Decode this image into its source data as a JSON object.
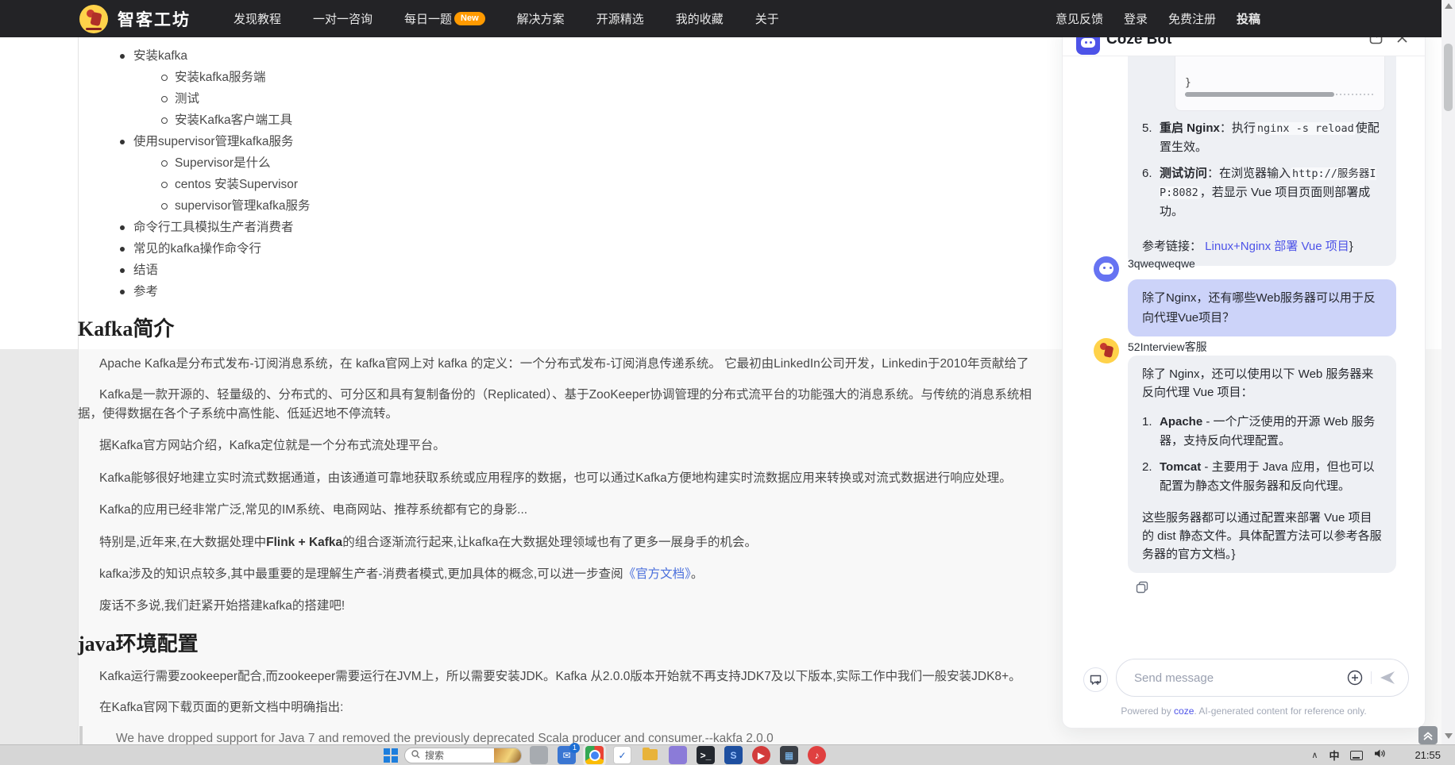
{
  "nav": {
    "brand": "智客工坊",
    "items": [
      {
        "label": "发现教程",
        "badge": ""
      },
      {
        "label": "一对一咨询",
        "badge": ""
      },
      {
        "label": "每日一题",
        "badge": "New"
      },
      {
        "label": "解决方案",
        "badge": ""
      },
      {
        "label": "开源精选",
        "badge": ""
      },
      {
        "label": "我的收藏",
        "badge": ""
      },
      {
        "label": "关于",
        "badge": ""
      }
    ],
    "right_items": {
      "feedback": "意见反馈",
      "login": "登录",
      "register": "免费注册",
      "submit": "投稿"
    }
  },
  "article": {
    "toc": [
      {
        "label": "安装kafka"
      },
      {
        "label": "安装kafka服务端"
      },
      {
        "label": "测试"
      },
      {
        "label": "安装Kafka客户端工具"
      },
      {
        "label": "使用supervisor管理kafka服务"
      },
      {
        "label": "Supervisor是什么"
      },
      {
        "label": "centos 安装Supervisor"
      },
      {
        "label": "supervisor管理kafka服务"
      },
      {
        "label": "命令行工具模拟生产者消费者"
      },
      {
        "label": "常见的kafka操作命令行"
      },
      {
        "label": "结语"
      },
      {
        "label": "参考"
      }
    ],
    "h1": "Kafka简介",
    "p1": "Apache Kafka是分布式发布-订阅消息系统，在 kafka官网上对 kafka 的定义：一个分布式发布-订阅消息传递系统。 它最初由LinkedIn公司开发，Linkedin于2010年贡献给了",
    "p2a": "Kafka是一款开源的、轻量级的、分布式的、可分区和具有复制备份的（Replicated）、基于ZooKeeper协调管理的分布式流平台的功能强大的消息系统。与传统的消息系统相",
    "p2b": "据，使得数据在各个子系统中高性能、低延迟地不停流转。",
    "p3": "据Kafka官方网站介绍，Kafka定位就是一个分布式流处理平台。",
    "p4": "Kafka能够很好地建立实时流式数据通道，由该通道可靠地获取系统或应用程序的数据，也可以通过Kafka方便地构建实时流数据应用来转换或对流式数据进行响应处理。",
    "p5": "Kafka的应用已经非常广泛,常见的IM系统、电商网站、推荐系统都有它的身影...",
    "p6_pre": "特别是,近年来,在大数据处理中",
    "p6_bold": "Flink + Kafka",
    "p6_post": "的组合逐渐流行起来,让kafka在大数据处理领域也有了更多一展身手的机会。",
    "p7_pre": "kafka涉及的知识点较多,其中最重要的是理解生产者-消费者模式,更加具体的概念,可以进一步查阅",
    "p7_link": "《官方文档》",
    "p7_post": "。",
    "p8": "废话不多说,我们赶紧开始搭建kafka的搭建吧!",
    "h2": "java环境配置",
    "p9": "Kafka运行需要zookeeper配合,而zookeeper需要运行在JVM上，所以需要安装JDK。Kafka 从2.0.0版本开始就不再支持JDK7及以下版本,实际工作中我们一般安装JDK8+。",
    "p10": "在Kafka官网下载页面的更新文档中明确指出:",
    "quote": "We have dropped support for Java 7 and removed the previously deprecated Scala producer and consumer.--kakfa 2.0.0"
  },
  "chat": {
    "title": "Coze Bot",
    "code_tail": "}",
    "item5_num": "5.",
    "item5_bold": "重启 Nginx",
    "item5_mid": "：执行",
    "item5_code": "nginx -s reload",
    "item5_post": "使配置生效。",
    "item6_num": "6.",
    "item6_bold": "测试访问",
    "item6_mid": "：在浏览器输入",
    "item6_code": "http://服务器IP:8082",
    "item6_post": "，若显示 Vue 项目页面则部署成功。",
    "ref_pre": "参考链接： ",
    "ref_link": "Linux+Nginx 部署 Vue 项目",
    "ref_post": "}",
    "user_name": "3qweqweqwe",
    "user_text": "除了Nginx，还有哪些Web服务器可以用于反向代理Vue项目？",
    "bot_name": "52Interview客服",
    "bot_p1": "除了 Nginx，还可以使用以下 Web 服务器来反向代理 Vue 项目：",
    "bot_li1_num": "1.",
    "bot_li1_bold": "Apache",
    "bot_li1_rest": " - 一个广泛使用的开源 Web 服务器，支持反向代理配置。",
    "bot_li2_num": "2.",
    "bot_li2_bold": "Tomcat",
    "bot_li2_rest": " - 主要用于 Java 应用，但也可以配置为静态文件服务器和反向代理。",
    "bot_p2": "这些服务器都可以通过配置来部署 Vue 项目的 dist 静态文件。具体配置方法可以参考各服务器的官方文档。}",
    "input_placeholder": "Send message",
    "powered_pre": "Powered by ",
    "powered_link": "coze",
    "powered_post": ". AI-generated content for reference only."
  },
  "taskbar": {
    "search_placeholder": "搜索",
    "tray_ime": "中",
    "time": "21:55",
    "apps": [
      {
        "name": "app-gray",
        "bg": "#a7abb0",
        "glyph": "",
        "glyphColor": "#fff"
      },
      {
        "name": "mail-app",
        "bg": "#3a76d2",
        "glyph": "✉",
        "glyphColor": "#fff",
        "badge": "1"
      },
      {
        "name": "chrome",
        "bg": "",
        "glyph": "",
        "glyphColor": "",
        "active": true
      },
      {
        "name": "check-app",
        "bg": "#ffffff",
        "glyph": "✓",
        "glyphColor": "#2563c9"
      },
      {
        "name": "folder",
        "bg": "",
        "glyph": "",
        "glyphColor": ""
      },
      {
        "name": "purple-app",
        "bg": "#8b7bd8",
        "glyph": "",
        "glyphColor": "#fff"
      },
      {
        "name": "terminal",
        "bg": "#23272e",
        "glyph": ">_",
        "glyphColor": "#fff"
      },
      {
        "name": "blue-app",
        "bg": "#1e4fa0",
        "glyph": "S",
        "glyphColor": "#9cc3ff"
      },
      {
        "name": "media-red",
        "bg": "#d23b3b",
        "glyph": "▶",
        "glyphColor": "#fff",
        "circle": true
      },
      {
        "name": "dark-app",
        "bg": "#3a3f46",
        "glyph": "▦",
        "glyphColor": "#7fc3ff"
      },
      {
        "name": "music-red",
        "bg": "#e04040",
        "glyph": "♪",
        "glyphColor": "#fff",
        "circle": true
      }
    ]
  },
  "colors": {
    "accent": "#4d53e8",
    "nav_bg": "#232326",
    "badge": "#ff9a00",
    "user_bubble": "#ccd3f9",
    "bot_bubble": "#eef0f4"
  }
}
